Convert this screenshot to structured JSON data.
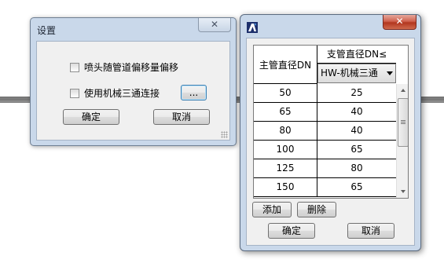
{
  "settings_dialog": {
    "title": "设置",
    "close_label": "✕",
    "checkbox_offset_label": "喷头随管道偏移量偏移",
    "checkbox_tee_label": "使用机械三通连接",
    "browse_label": "...",
    "ok_label": "确定",
    "cancel_label": "取消"
  },
  "tee_dialog": {
    "close_label": "✕",
    "header_main": "主管直径DN",
    "header_branch": "支管直径DN≤",
    "combo_value": "HW-机械三通",
    "rows": [
      {
        "main": "50",
        "branch": "25"
      },
      {
        "main": "65",
        "branch": "40"
      },
      {
        "main": "80",
        "branch": "40"
      },
      {
        "main": "100",
        "branch": "65"
      },
      {
        "main": "125",
        "branch": "80"
      },
      {
        "main": "150",
        "branch": "65"
      }
    ],
    "add_label": "添加",
    "delete_label": "删除",
    "ok_label": "确定",
    "cancel_label": "取消"
  },
  "colors": {
    "frame": "#c9d8ea",
    "client": "#f0f0f0",
    "close_active": "#c24d38"
  }
}
